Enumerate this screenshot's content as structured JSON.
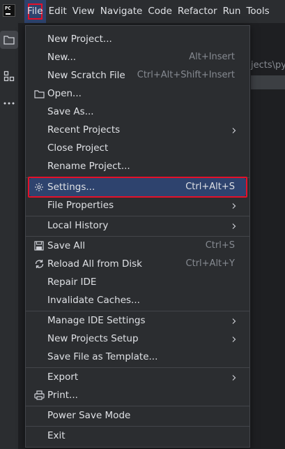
{
  "menubar": {
    "items": [
      {
        "label": "File"
      },
      {
        "label": "Edit"
      },
      {
        "label": "View"
      },
      {
        "label": "Navigate"
      },
      {
        "label": "Code"
      },
      {
        "label": "Refactor"
      },
      {
        "label": "Run"
      },
      {
        "label": "Tools"
      }
    ]
  },
  "app_logo": {
    "text": "PC"
  },
  "background": {
    "path_fragment": "jects\\py"
  },
  "file_menu": {
    "items": [
      {
        "label": "New Project...",
        "shortcut": ""
      },
      {
        "label": "New...",
        "shortcut": "Alt+Insert"
      },
      {
        "label": "New Scratch File",
        "shortcut": "Ctrl+Alt+Shift+Insert"
      },
      {
        "label": "Open...",
        "shortcut": ""
      },
      {
        "label": "Save As...",
        "shortcut": ""
      },
      {
        "label": "Recent Projects",
        "shortcut": ""
      },
      {
        "label": "Close Project",
        "shortcut": ""
      },
      {
        "label": "Rename Project...",
        "shortcut": ""
      },
      {
        "label": "Settings...",
        "shortcut": "Ctrl+Alt+S"
      },
      {
        "label": "File Properties",
        "shortcut": ""
      },
      {
        "label": "Local History",
        "shortcut": ""
      },
      {
        "label": "Save All",
        "shortcut": "Ctrl+S"
      },
      {
        "label": "Reload All from Disk",
        "shortcut": "Ctrl+Alt+Y"
      },
      {
        "label": "Repair IDE",
        "shortcut": ""
      },
      {
        "label": "Invalidate Caches...",
        "shortcut": ""
      },
      {
        "label": "Manage IDE Settings",
        "shortcut": ""
      },
      {
        "label": "New Projects Setup",
        "shortcut": ""
      },
      {
        "label": "Save File as Template...",
        "shortcut": ""
      },
      {
        "label": "Export",
        "shortcut": ""
      },
      {
        "label": "Print...",
        "shortcut": ""
      },
      {
        "label": "Power Save Mode",
        "shortcut": ""
      },
      {
        "label": "Exit",
        "shortcut": ""
      }
    ]
  },
  "colors": {
    "highlight": "#2e436e",
    "annotation": "#e5102a",
    "background": "#2b2d30"
  }
}
